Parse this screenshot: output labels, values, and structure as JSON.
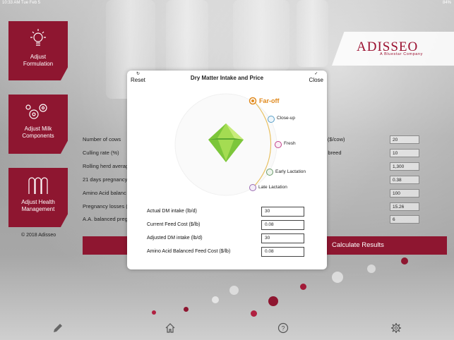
{
  "status_bar": {
    "time_date": "10:33 AM  Tue Feb 5",
    "battery": "84%"
  },
  "brand": {
    "name": "ADISSEO",
    "tagline": "A Bluestar Company"
  },
  "sidebar": {
    "items": [
      {
        "label_line1": "Adjust",
        "label_line2": "Formulation",
        "icon": "lightbulb-icon"
      },
      {
        "label_line1": "Adjust Milk",
        "label_line2": "Components",
        "icon": "gears-icon"
      },
      {
        "label_line1": "Adjust Health",
        "label_line2": "Management",
        "icon": "stalls-icon"
      }
    ],
    "copyright": "© 2018 Adisseo"
  },
  "form": {
    "labels": [
      "Number of cows",
      "Culling rate (%)",
      "Rolling herd averag",
      "21 days pregnancy",
      "Amino Acid balanc",
      "Pregnancy losses (",
      "A.A. balanced preg"
    ],
    "right_labels": [
      "st ($/cow)",
      "to breed"
    ],
    "right_values": [
      "20",
      "10",
      "1,300",
      "0.38",
      "100",
      "15.26",
      "6"
    ],
    "calculate_label": "Calculate Results"
  },
  "modal": {
    "title": "Dry Matter Intake and Price",
    "reset_label": "Reset",
    "close_label": "Close",
    "stages": [
      "Far-off",
      "Close-up",
      "Fresh",
      "Early Lactation",
      "Late Lactation"
    ],
    "selected_stage": "Far-off",
    "stage_colors": [
      "#e08a1e",
      "#5aa0c8",
      "#c0408a",
      "#6a9a6a",
      "#9a6ab0"
    ],
    "fields": [
      {
        "label": "Actual DM intake (lb/d)",
        "value": "30"
      },
      {
        "label": "Current Feed Cost ($/lb)",
        "value": "0.08"
      },
      {
        "label": "Adjusted DM intake (lb/d)",
        "value": "30"
      },
      {
        "label": "Amino Acid Balanced Feed Cost ($/lb)",
        "value": "0.08"
      }
    ]
  },
  "toolbar": {
    "icons": [
      "pencil-icon",
      "home-icon",
      "help-icon",
      "settings-icon"
    ]
  },
  "colors": {
    "brand": "#8e1630",
    "accent": "#e08a1e",
    "gem": "#7cc63a"
  }
}
